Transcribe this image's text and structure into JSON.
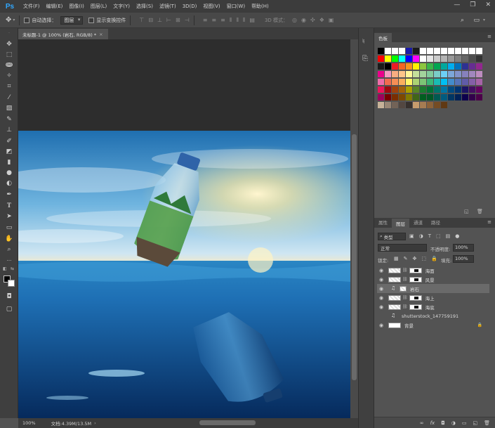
{
  "app": {
    "logo": "Ps"
  },
  "menu": [
    "文件(F)",
    "编辑(E)",
    "图像(I)",
    "图层(L)",
    "文字(Y)",
    "选择(S)",
    "滤镜(T)",
    "3D(D)",
    "视图(V)",
    "窗口(W)",
    "帮助(H)"
  ],
  "window_controls": {
    "minimize": "—",
    "maximize": "❐",
    "close": "✕"
  },
  "options_bar": {
    "auto_select_label": "自动选择：",
    "auto_select_value": "图层",
    "show_transform_label": "显示变换控件",
    "mode_3d_label": "3D 模式："
  },
  "document": {
    "tab_title": "未标题-1 @ 100% (岩石, RGB/8) *",
    "tab_close": "×"
  },
  "status": {
    "zoom": "100%",
    "doc_info": "文档:4.39M/13.5M"
  },
  "swatches_panel": {
    "tab": "色板"
  },
  "swatch_colors": {
    "row1": [
      "#000000",
      "#ffffff",
      "#ffffff",
      "#ffffff",
      "#1a1aaa",
      "#1a1a1a",
      "#ffffff",
      "#ffffff",
      "#ffffff",
      "#ffffff",
      "#ffffff",
      "#ffffff",
      "#ffffff",
      "#ffffff",
      "#ffffff"
    ],
    "row2": [
      "#ff0000",
      "#ffff00",
      "#00ff00",
      "#00ffff",
      "#0000ff",
      "#ff00ff",
      "#ffffff",
      "#e6e6e6",
      "#cccccc",
      "#b3b3b3",
      "#999999",
      "#808080",
      "#666666",
      "#4d4d4d",
      "#333333"
    ],
    "row3": [
      "#1a1a1a",
      "#000000",
      "#ed1c24",
      "#f26522",
      "#f7941d",
      "#fff200",
      "#8dc63f",
      "#39b54a",
      "#00a651",
      "#00a99d",
      "#00aeef",
      "#0072bc",
      "#2e3192",
      "#662d91",
      "#92278f"
    ],
    "row4": [
      "#ec008c",
      "#f49ac1",
      "#f9ad81",
      "#fdc68a",
      "#fff799",
      "#c4df9b",
      "#a3d39c",
      "#82ca9c",
      "#7accc8",
      "#6dcff6",
      "#7da7d9",
      "#8393ca",
      "#8781bd",
      "#a187be",
      "#bd8cbf"
    ],
    "row5": [
      "#f06eaa",
      "#f26c4f",
      "#f68e56",
      "#fbaf5d",
      "#fff568",
      "#acd373",
      "#7cc576",
      "#3bb878",
      "#1abbb4",
      "#00bff3",
      "#438ccb",
      "#5574b9",
      "#605ca8",
      "#855fa8",
      "#a763a8"
    ],
    "row6": [
      "#ed145b",
      "#9e0b0f",
      "#a0410d",
      "#a36209",
      "#aba000",
      "#598527",
      "#1a7b30",
      "#007236",
      "#00746b",
      "#0076a3",
      "#004a80",
      "#003471",
      "#1b1464",
      "#440e62",
      "#630460"
    ],
    "row7": [
      "#9e005d",
      "#790000",
      "#7b2e00",
      "#7d4900",
      "#827b00",
      "#406618",
      "#005e20",
      "#005826",
      "#005952",
      "#005b7f",
      "#003663",
      "#002157",
      "#0d004c",
      "#32004b",
      "#4b0049"
    ],
    "row8": [
      "#c7b299",
      "#998675",
      "#736357",
      "#534741",
      "#37302d",
      "#c69c6d",
      "#a67c52",
      "#8c6239",
      "#754c24",
      "#603913"
    ]
  },
  "layers_panel": {
    "tabs": [
      "属性",
      "图层",
      "通道",
      "路径"
    ],
    "filter_kind": "类型",
    "blend_mode": "正常",
    "opacity_label": "不透明度:",
    "opacity_value": "100%",
    "lock_label": "锁定:",
    "fill_label": "填充:",
    "fill_value": "100%",
    "layers": [
      {
        "name": "海面",
        "selected": false,
        "type": "masked"
      },
      {
        "name": "风景",
        "selected": false,
        "type": "masked"
      },
      {
        "name": "岩石",
        "selected": true,
        "type": "smart"
      },
      {
        "name": "海上",
        "selected": false,
        "type": "masked"
      },
      {
        "name": "海底",
        "selected": false,
        "type": "masked"
      },
      {
        "name": "shutterstock_147759191",
        "selected": false,
        "type": "smart-noeye"
      },
      {
        "name": "背景",
        "selected": false,
        "type": "background"
      }
    ],
    "bottom_icons": [
      "link-icon",
      "fx-icon",
      "mask-icon",
      "adjustment-icon",
      "group-icon",
      "new-layer-icon",
      "trash-icon"
    ],
    "fx_label": "fx"
  }
}
